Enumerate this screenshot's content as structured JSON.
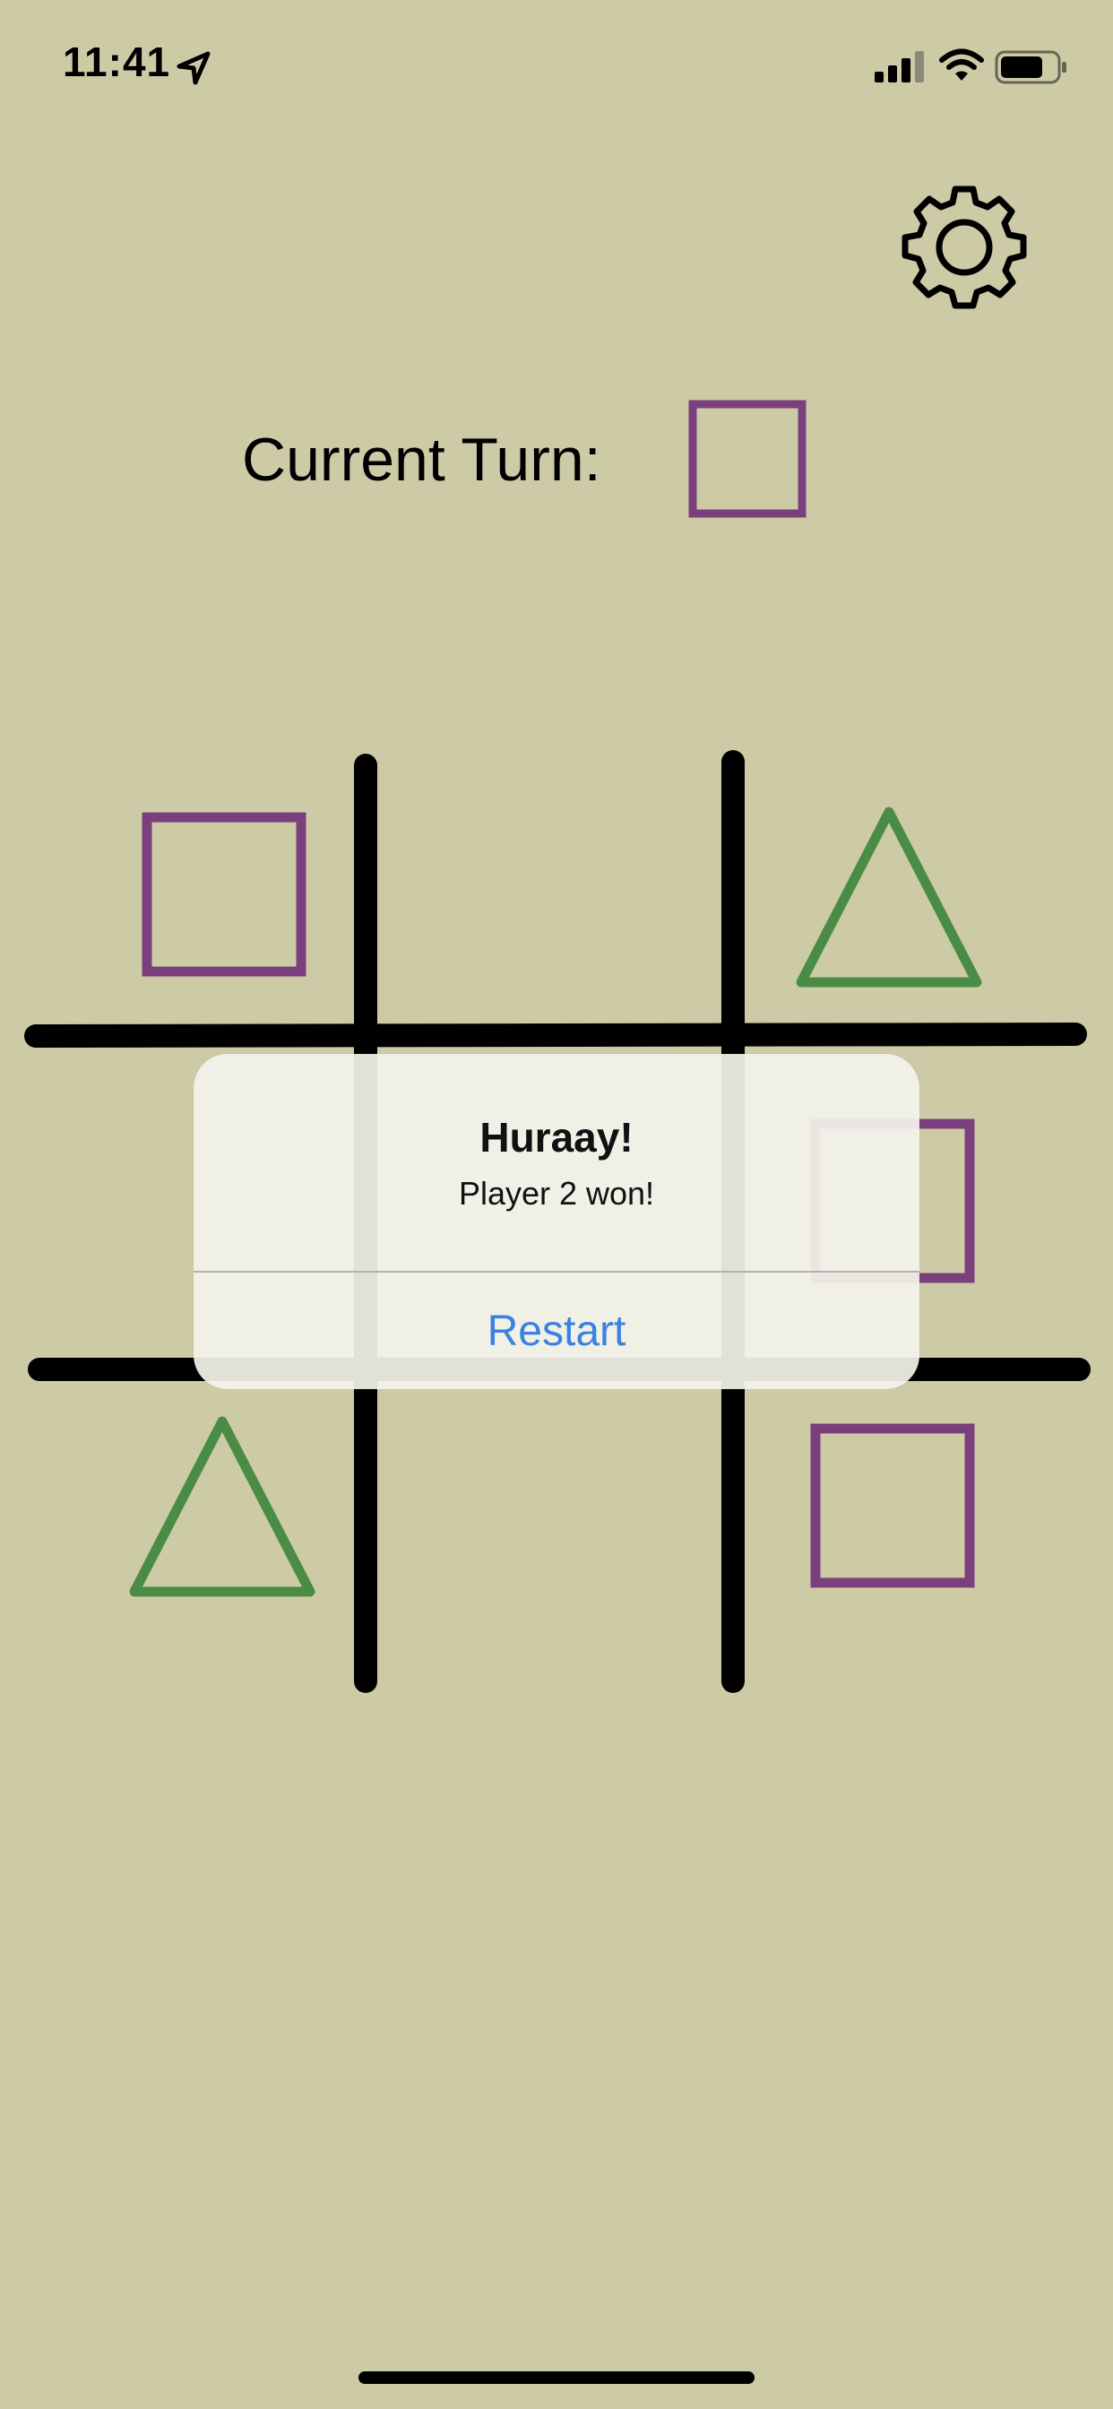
{
  "status_bar": {
    "time": "11:41",
    "icons": [
      "location-arrow-icon",
      "cellular-signal-icon",
      "wifi-icon",
      "battery-icon"
    ]
  },
  "header": {
    "settings_icon": "gear-icon",
    "turn_label": "Current Turn:",
    "current_turn_piece": "square"
  },
  "board": {
    "cells": [
      [
        "square",
        "",
        "triangle"
      ],
      [
        "",
        "",
        "square"
      ],
      [
        "triangle",
        "",
        "square"
      ]
    ]
  },
  "alert": {
    "title": "Huraay!",
    "message": "Player 2 won!",
    "button_label": "Restart"
  },
  "colors": {
    "background": "#cdcba6",
    "square": "#7b3f7e",
    "triangle": "#4a8c46",
    "grid": "#000000",
    "link": "#3a82e0"
  }
}
